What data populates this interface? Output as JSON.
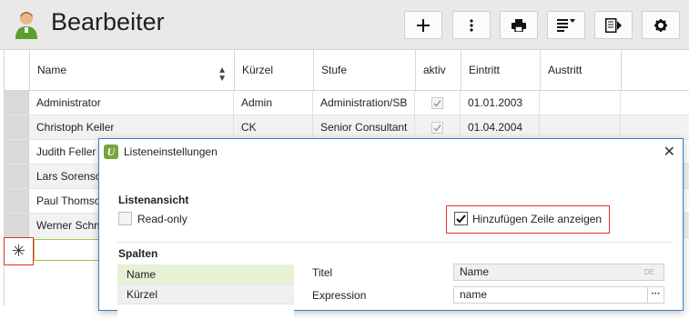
{
  "header": {
    "title": "Bearbeiter",
    "buttons": [
      {
        "name": "add-button",
        "icon": "plus-icon"
      },
      {
        "name": "more-button",
        "icon": "vertical-dots-icon"
      },
      {
        "name": "print-button",
        "icon": "printer-icon"
      },
      {
        "name": "list-filter-button",
        "icon": "list-sort-icon"
      },
      {
        "name": "export-button",
        "icon": "document-arrow-icon"
      },
      {
        "name": "settings-button",
        "icon": "gear-icon"
      }
    ]
  },
  "table": {
    "columns": [
      "Name",
      "Kürzel",
      "Stufe",
      "aktiv",
      "Eintritt",
      "Austritt"
    ],
    "rows": [
      {
        "name": "Administrator",
        "kuerzel": "Admin",
        "stufe": "Administration/SB",
        "aktiv": true,
        "eintritt": "01.01.2003",
        "austritt": ""
      },
      {
        "name": "Christoph Keller",
        "kuerzel": "CK",
        "stufe": "Senior Consultant",
        "aktiv": true,
        "eintritt": "01.04.2004",
        "austritt": ""
      },
      {
        "name": "Judith Feller",
        "kuerzel": "",
        "stufe": "",
        "aktiv": null,
        "eintritt": "",
        "austritt": ""
      },
      {
        "name": "Lars Sorenson",
        "kuerzel": "",
        "stufe": "",
        "aktiv": null,
        "eintritt": "",
        "austritt": ""
      },
      {
        "name": "Paul Thomson",
        "kuerzel": "",
        "stufe": "",
        "aktiv": null,
        "eintritt": "",
        "austritt": ""
      },
      {
        "name": "Werner Schm",
        "kuerzel": "",
        "stufe": "",
        "aktiv": null,
        "eintritt": "",
        "austritt": ""
      }
    ],
    "new_row_marker": "✳"
  },
  "dialog": {
    "title": "Listeneinstellungen",
    "logo_letter": "U",
    "close_label": "✕",
    "listview": {
      "heading": "Listenansicht",
      "readonly_label": "Read-only",
      "readonly_checked": false,
      "add_row_label": "Hinzufügen Zeile anzeigen",
      "add_row_checked": true
    },
    "columns": {
      "heading": "Spalten",
      "items": [
        "Name",
        "Kürzel"
      ],
      "selected": "Name",
      "titel_label": "Titel",
      "titel_value": "Name",
      "titel_lang": "DE",
      "expression_label": "Expression",
      "expression_value": "name",
      "expression_button": "···"
    }
  },
  "colors": {
    "header_bg": "#e9e9e9",
    "accent_green": "#9ac63c",
    "highlight_red": "#dd3333",
    "dialog_border": "#3a7fd0"
  }
}
